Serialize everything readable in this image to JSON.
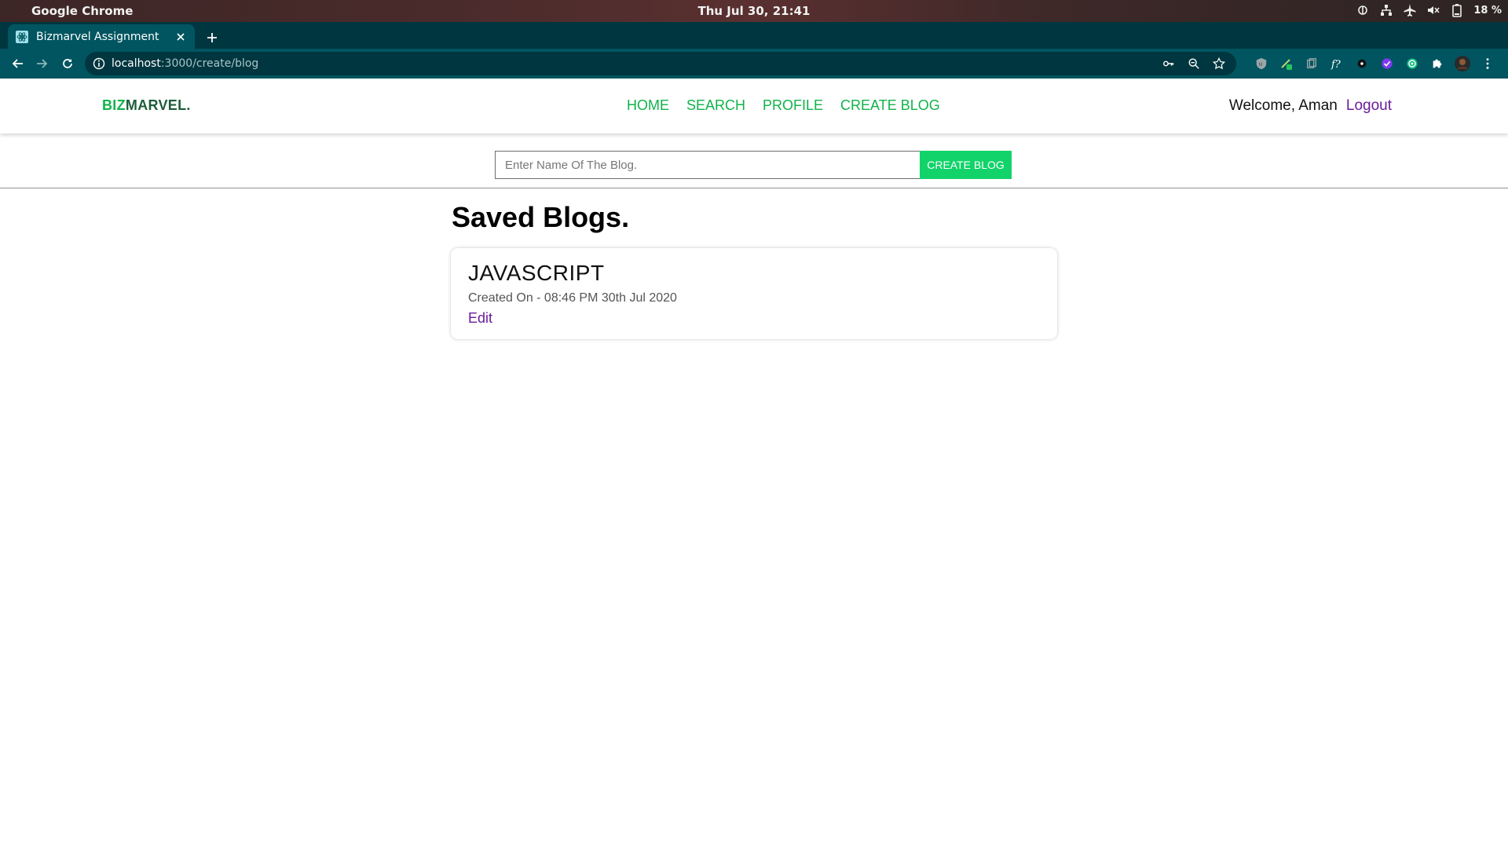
{
  "os": {
    "app_name": "Google Chrome",
    "clock": "Thu Jul 30, 21:41",
    "battery": "18 %"
  },
  "browser": {
    "tab_title": "Bizmarvel Assignment",
    "url_host": "localhost",
    "url_path": ":3000/create/blog"
  },
  "navbar": {
    "brand_part1": "BIZ",
    "brand_part2": "MARVEL.",
    "links": [
      "HOME",
      "SEARCH",
      "PROFILE",
      "CREATE BLOG"
    ],
    "welcome": "Welcome, Aman",
    "logout": "Logout"
  },
  "create": {
    "placeholder": "Enter Name Of The Blog.",
    "value": "",
    "button_label": "CREATE BLOG"
  },
  "saved": {
    "heading": "Saved Blogs.",
    "blogs": [
      {
        "title": "JAVASCRIPT",
        "created": "Created On - 08:46 PM 30th Jul 2020",
        "edit_label": "Edit"
      }
    ]
  },
  "colors": {
    "brand_green": "#10b34a",
    "brand_dark": "#1d5c3a",
    "button_green": "#11d36a",
    "link_purple": "#6a1b9a",
    "chrome_toolbar": "#005560",
    "chrome_tabstrip": "#00363f"
  }
}
